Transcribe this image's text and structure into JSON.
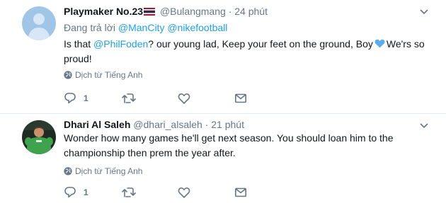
{
  "tweets": [
    {
      "name": "Playmaker No.23",
      "handle": "@Bulangmang",
      "separator": "·",
      "time": "24 phút",
      "reply_prefix": "Đang trả lời",
      "reply_mention_1": "@ManCity",
      "reply_mention_2": "@nikefootball",
      "text_before": "Is that",
      "text_mention": "@PhilFoden",
      "text_after": "? our young lad, Keep your feet on the ground, Boy",
      "text_end": "We'rs so proud!",
      "translate": "Dịch từ Tiếng Anh",
      "reply_count": "1",
      "avatar_icon": "default-profile-icon",
      "flag_icon": "thailand-flag-icon"
    },
    {
      "name": "Dhari Al Saleh",
      "handle": "@dhari_alsaleh",
      "separator": "·",
      "time": "21 phút",
      "text": "Wonder how many games he'll get next season. You should loan him to the championship then prem the year after.",
      "translate": "Dịch từ Tiếng Anh",
      "reply_count": "1",
      "avatar_icon": "goalkeeper-photo"
    }
  ],
  "colors": {
    "link": "#1da1f2",
    "secondary_text": "#657786",
    "primary_text": "#14171a",
    "divider": "#e6ecf0",
    "heart_emoji": "#5dadec"
  }
}
